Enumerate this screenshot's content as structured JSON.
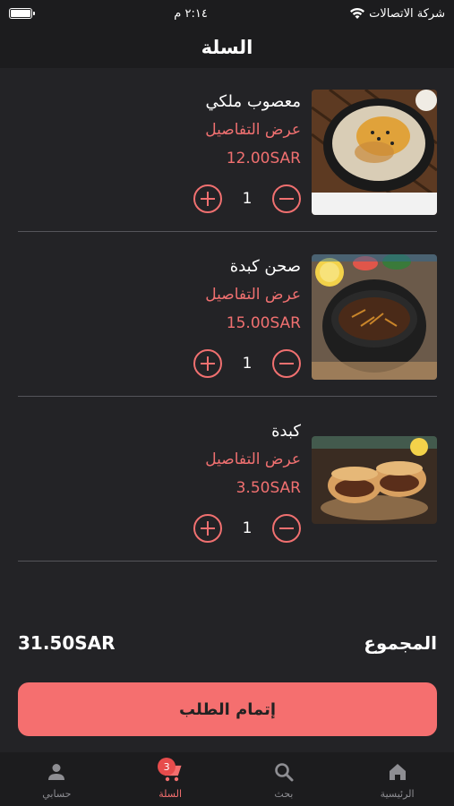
{
  "status_bar": {
    "carrier": "شركة الاتصالات",
    "time": "٢:١٤ م"
  },
  "header": {
    "title": "السلة"
  },
  "cart": {
    "items": [
      {
        "name": "معصوب ملكي",
        "details_label": "عرض التفاصيل",
        "price": "12.00SAR",
        "quantity": "1"
      },
      {
        "name": "صحن كبدة",
        "details_label": "عرض التفاصيل",
        "price": "15.00SAR",
        "quantity": "1"
      },
      {
        "name": "كبدة",
        "details_label": "عرض التفاصيل",
        "price": "3.50SAR",
        "quantity": "1"
      }
    ]
  },
  "summary": {
    "total_label": "المجموع",
    "total_amount": "31.50SAR"
  },
  "checkout": {
    "label": "إتمام الطلب"
  },
  "tab_bar": {
    "tabs": [
      {
        "label": "حسابي",
        "icon": "person-icon"
      },
      {
        "label": "السلة",
        "icon": "cart-icon",
        "badge": "3"
      },
      {
        "label": "بحث",
        "icon": "search-icon"
      },
      {
        "label": "الرئيسية",
        "icon": "home-icon"
      }
    ]
  },
  "colors": {
    "accent": "#f56f6f",
    "background": "#232326",
    "bar_background": "#1c1c1e"
  }
}
